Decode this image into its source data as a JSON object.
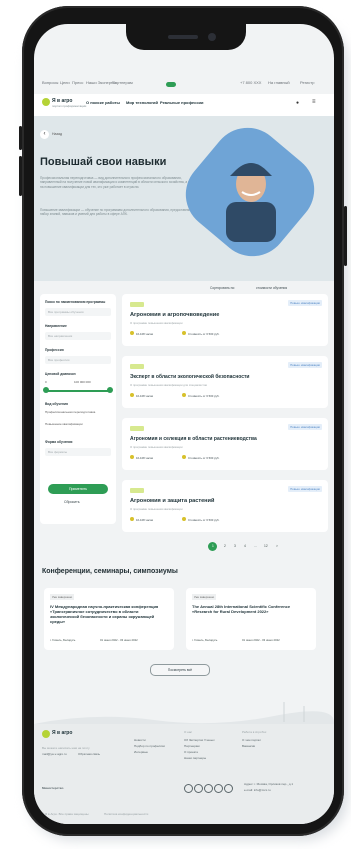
{
  "colors": {
    "brand_green": "#2e9d55",
    "brand_lime": "#b5d336",
    "hero_bg": "#dfe7ea",
    "text_dark": "#1e2c31",
    "tag_blue": "#4d84c4"
  },
  "topbar": {
    "links": [
      "Вопросы",
      "Цели",
      "Пресс",
      "Наши Эксперты",
      "Партнерам"
    ],
    "right": [
      "+7 800 XXX",
      "На главный",
      "Регистр"
    ]
  },
  "header": {
    "logo_title": "Я в агро",
    "logo_sub": "портал профориентации",
    "nav": [
      "О поиске работы",
      "Мир технологий",
      "Реальные профессии"
    ]
  },
  "hero": {
    "back_label": "Назад",
    "title": "Повышай свои навыки",
    "paragraph1": "Профессиональная переподготовка — вид дополнительного профессионального образования, направленный на получение новой квалификации и компетенций в области сельского хозяйства, а также на повышение квалификации для тех, кто уже работает в отрасли.",
    "paragraph2": "Повышение квалификации — обучение по программам дополнительного образования, предоставляющим набор знаний, навыков и умений для работы в сфере АПК."
  },
  "filters": {
    "program_name_label": "Поиск по наименованию программы",
    "program_name_placeholder": "Все программы обучения",
    "direction_label": "Направление",
    "direction_value": "Все направления",
    "profession_label": "Профессия",
    "profession_value": "Все профессии",
    "price_label": "Ценовой диапазон",
    "price_from": "0",
    "price_to": "100 000 000",
    "edu_type_label": "Вид обучения",
    "edu_types": [
      "Профессиональная переподготовка",
      "Повышение квалификации"
    ],
    "form_label": "Форма обучения",
    "form_value": "Все форматы",
    "apply_label": "Применить",
    "reset_label": "Сбросить"
  },
  "sort": {
    "label": "Сортировать по:",
    "value": "стоимости обучения"
  },
  "courses": [
    {
      "tag": "Повыш. квалификации",
      "title": "Агрономия и агропочвоведение",
      "subtitle": "О программе повышения квалификации",
      "duration": "16-108 часов",
      "price": "Стоимость от 6 500 руб."
    },
    {
      "tag": "Повыш. квалификации",
      "title": "Эксперт в области экологической безопасности",
      "subtitle": "О программе повышения квалификации для специалистов",
      "duration": "16-108 часов",
      "price": "Стоимость от 6 500 руб."
    },
    {
      "tag": "Повыш. квалификации",
      "title": "Агрономия и селекция в области растениеводства",
      "subtitle": "О программе повышения квалификации",
      "duration": "16-108 часов",
      "price": "Стоимость от 6 500 руб."
    },
    {
      "tag": "Повыш. квалификации",
      "title": "Агрономия и защита растений",
      "subtitle": "О программе повышения квалификации",
      "duration": "16-108 часов",
      "price": "Стоимость от 6 500 руб."
    }
  ],
  "pagination": {
    "pages": [
      "1",
      "2",
      "3",
      "4",
      "...",
      "12"
    ],
    "next": ">"
  },
  "conferences": {
    "title": "Конференции, семинары, симпозиумы",
    "items": [
      {
        "tag": "Уже завершено",
        "title": "IV Международная научно-практическая конференция «Трансграничное сотрудничество в области экологической безопасности и охраны окружающей среды»",
        "place": "г. Гомель, Беларусь",
        "dates": "01 июня 2022 - 03 июня 2022"
      },
      {
        "tag": "Уже завершено",
        "title": "The Annual 28th International Scientific Conference «Research for Rural Development 2022»",
        "place": "г. Гомель, Беларусь",
        "dates": "01 июня 2022 - 03 июня 2022"
      }
    ],
    "more_label": "Посмотреть всё"
  },
  "footer": {
    "logo_title": "Я в агро",
    "email_label": "Вы можете написать нам на почту",
    "email": "mail@ya-v-agro.ru",
    "feedback": "Обратная связь",
    "col1": [
      "Новости",
      "Подбор по профессии",
      "Интервью"
    ],
    "col2_head": "О нас",
    "col2": [
      "Об Экспертах Ученых",
      "Партнерам",
      "О проекте",
      "Наши партнеры"
    ],
    "col3_head": "Работа в АгроТех",
    "col3": [
      "О чем портал",
      "Вакансии"
    ],
    "ministry": "Министерство",
    "address": "Адрес: г. Москва, Орликов пер., д.1",
    "site": "e-mail: info@mcx.ru",
    "bottom": [
      "© Я в Агро. Все права защищены",
      "Политика конфиденциальности"
    ]
  }
}
